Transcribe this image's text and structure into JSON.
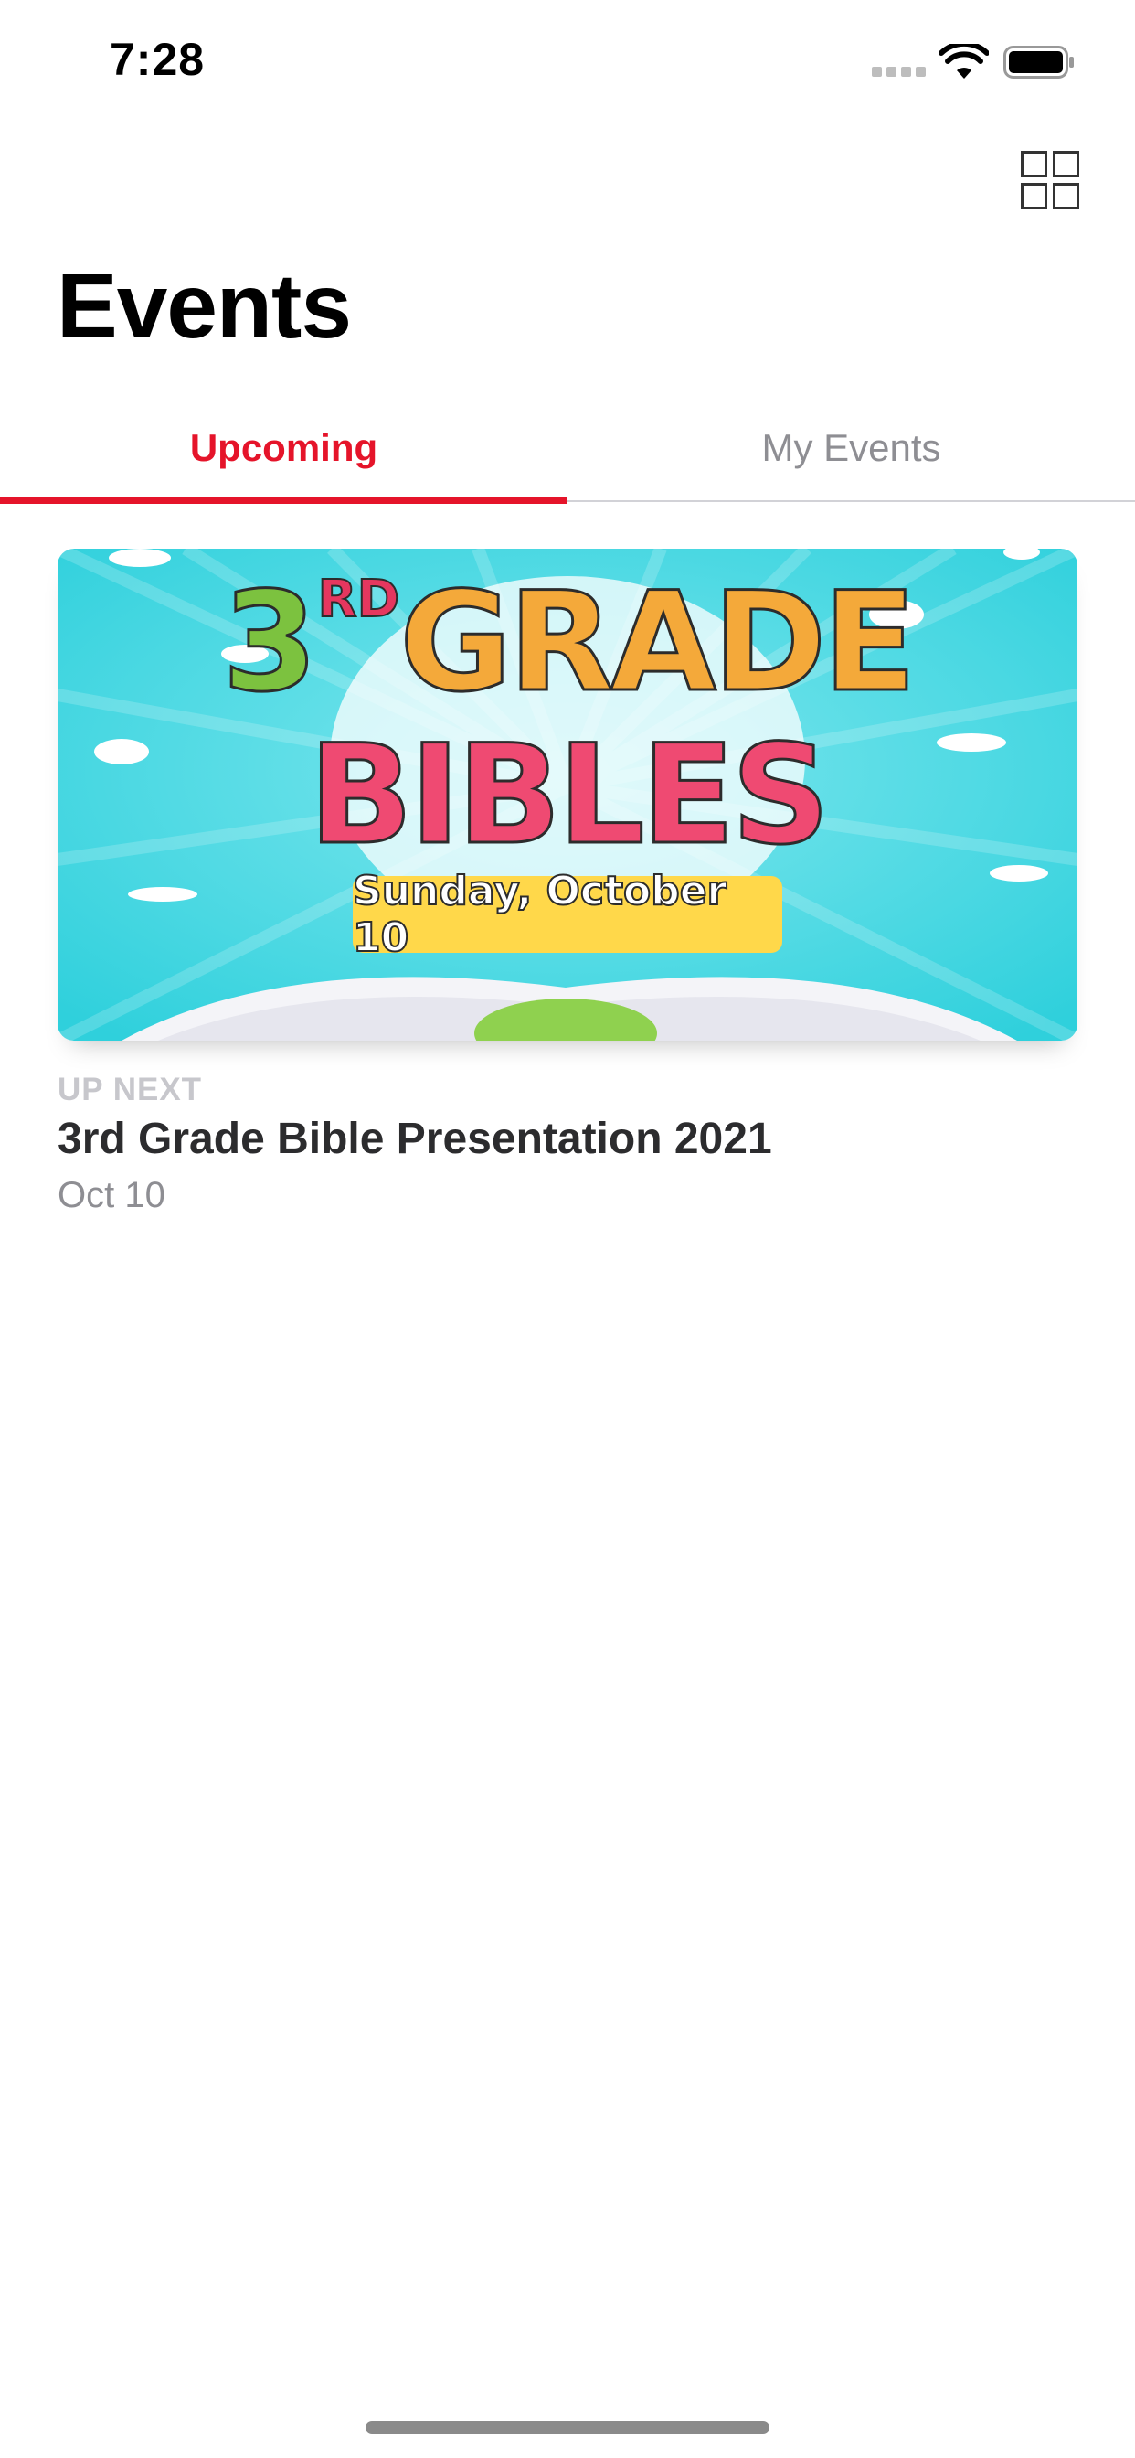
{
  "status_bar": {
    "time": "7:28"
  },
  "header": {
    "title": "Events",
    "layout_toggle_icon": "grid-icon"
  },
  "tabs": [
    {
      "label": "Upcoming",
      "active": true
    },
    {
      "label": "My Events",
      "active": false
    }
  ],
  "accent_color": "#e5142a",
  "event": {
    "section_label": "UP NEXT",
    "title": "3rd Grade Bible Presentation 2021",
    "date": "Oct 10",
    "image": {
      "line1_number": "3",
      "line1_suffix": "RD",
      "line1_word": "GRADE",
      "line2_word": "BIBLES",
      "banner_text": "Sunday, October 10",
      "background_color": "#3fd3df"
    }
  }
}
